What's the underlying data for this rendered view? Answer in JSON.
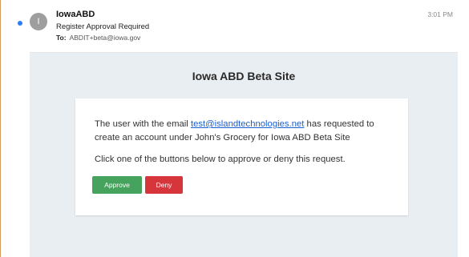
{
  "header": {
    "sender": "IowaABD",
    "avatar_initial": "I",
    "subject": "Register Approval Required",
    "to_label": "To:",
    "to_address": "ABDIT+beta@iowa.gov",
    "time": "3:01 PM"
  },
  "body": {
    "site_title": "Iowa ABD Beta Site",
    "message_prefix": "The user with the email ",
    "email_link": "test@islandtechnologies.net",
    "message_suffix": " has requested to create an account under John's Grocery for Iowa ABD Beta Site",
    "instruction": "Click one of the buttons below to approve or deny this request.",
    "approve_label": "Approve",
    "deny_label": "Deny"
  },
  "colors": {
    "unread_dot": "#2f7cf6",
    "approve": "#46a35e",
    "deny": "#d6353b",
    "link": "#1a5fd0",
    "body_background": "#e9eef2"
  }
}
